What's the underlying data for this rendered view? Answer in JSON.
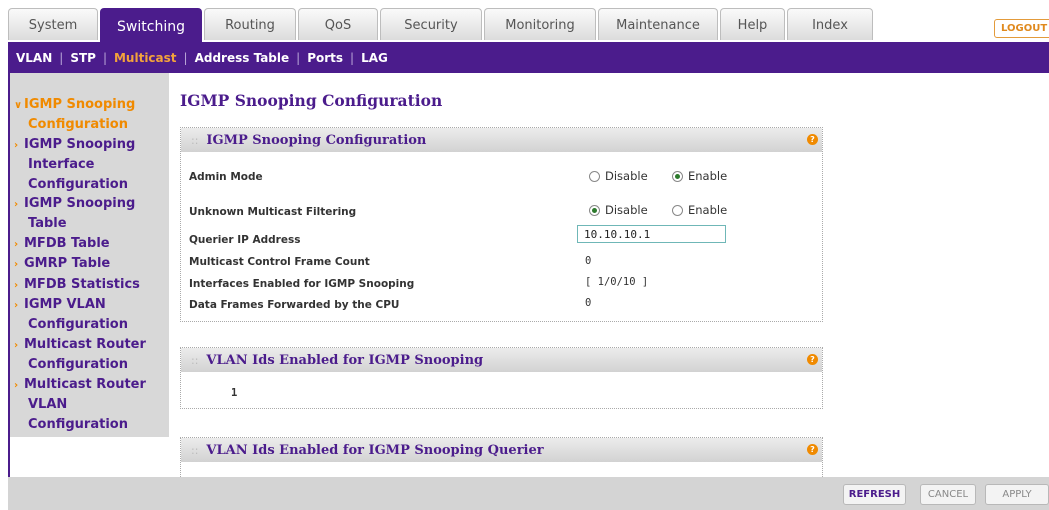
{
  "top_tabs": [
    {
      "label": "System",
      "active": false
    },
    {
      "label": "Switching",
      "active": true
    },
    {
      "label": "Routing",
      "active": false
    },
    {
      "label": "QoS",
      "active": false
    },
    {
      "label": "Security",
      "active": false
    },
    {
      "label": "Monitoring",
      "active": false
    },
    {
      "label": "Maintenance",
      "active": false
    },
    {
      "label": "Help",
      "active": false
    },
    {
      "label": "Index",
      "active": false
    }
  ],
  "logout_label": "LOGOUT",
  "subnav": [
    {
      "label": "VLAN",
      "active": false
    },
    {
      "label": "STP",
      "active": false
    },
    {
      "label": "Multicast",
      "active": true
    },
    {
      "label": "Address Table",
      "active": false
    },
    {
      "label": "Ports",
      "active": false
    },
    {
      "label": "LAG",
      "active": false
    }
  ],
  "sidebar": [
    {
      "lines": [
        "IGMP Snooping",
        "Configuration"
      ],
      "active": true
    },
    {
      "lines": [
        "IGMP Snooping",
        "Interface",
        "Configuration"
      ],
      "active": false
    },
    {
      "lines": [
        "IGMP Snooping",
        "Table"
      ],
      "active": false
    },
    {
      "lines": [
        "MFDB Table"
      ],
      "active": false
    },
    {
      "lines": [
        "GMRP Table"
      ],
      "active": false
    },
    {
      "lines": [
        "MFDB Statistics"
      ],
      "active": false
    },
    {
      "lines": [
        "IGMP VLAN",
        "Configuration"
      ],
      "active": false
    },
    {
      "lines": [
        "Multicast Router",
        "Configuration"
      ],
      "active": false
    },
    {
      "lines": [
        "Multicast Router",
        "VLAN",
        "Configuration"
      ],
      "active": false
    }
  ],
  "page_title": "IGMP Snooping Configuration",
  "config_panel": {
    "title": "IGMP Snooping Configuration",
    "help": "?",
    "admin_mode": {
      "label": "Admin Mode",
      "options": [
        "Disable",
        "Enable"
      ],
      "selected": "Enable"
    },
    "unknown_multicast_filtering": {
      "label": "Unknown Multicast Filtering",
      "options": [
        "Disable",
        "Enable"
      ],
      "selected": "Disable"
    },
    "querier_ip": {
      "label": "Querier IP Address",
      "value": "10.10.10.1"
    },
    "control_frame_count": {
      "label": "Multicast Control Frame Count",
      "value": "0"
    },
    "interfaces_enabled": {
      "label": "Interfaces Enabled for IGMP Snooping",
      "value": "[ 1/0/10 ]"
    },
    "data_frames_cpu": {
      "label": "Data Frames Forwarded by the CPU",
      "value": "0"
    }
  },
  "vlan_panel": {
    "title": "VLAN Ids Enabled for IGMP Snooping",
    "help": "?",
    "value": "1"
  },
  "querier_panel": {
    "title": "VLAN Ids Enabled for IGMP Snooping Querier",
    "help": "?"
  },
  "buttons": {
    "refresh": "REFRESH",
    "cancel": "CANCEL",
    "apply": "APPLY"
  },
  "colors": {
    "brand_purple": "#4b1c8c",
    "accent_orange": "#f08a00"
  }
}
